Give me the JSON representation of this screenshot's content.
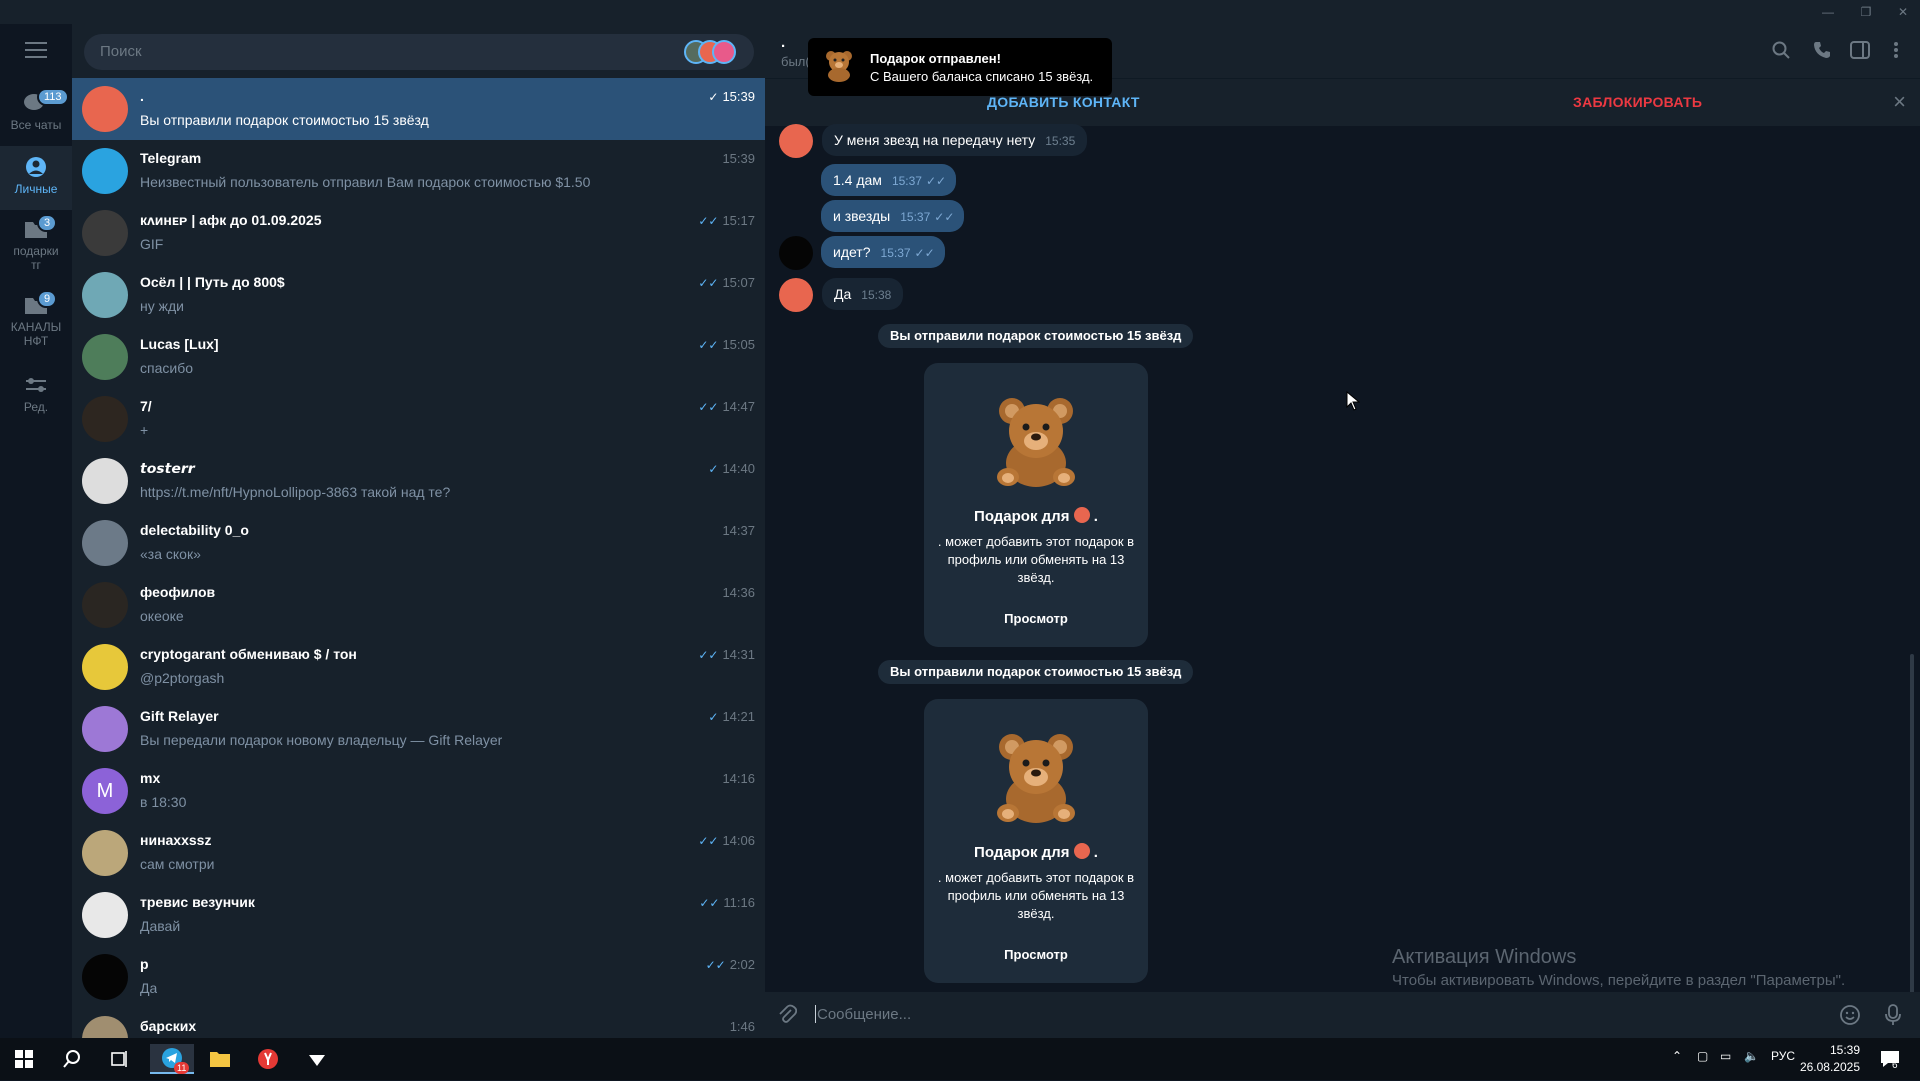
{
  "window": {
    "minimize": "—",
    "restore": "❐",
    "close": "✕"
  },
  "folders": [
    {
      "label": "Все чаты",
      "badge": "113",
      "icon": "chats-icon"
    },
    {
      "label": "Личные",
      "badge": "",
      "icon": "user-icon"
    },
    {
      "label": "подарки тг",
      "badge": "3",
      "icon": "folder-icon"
    },
    {
      "label": "КАНАЛЫ НФТ",
      "badge": "9",
      "icon": "folder-icon"
    },
    {
      "label": "Ред.",
      "badge": "",
      "icon": "edit-icon"
    }
  ],
  "search": {
    "placeholder": "Поиск"
  },
  "chats": [
    {
      "name": ".",
      "message": "Вы отправили подарок стоимостью 15 звёзд",
      "time": "15:39",
      "check": "✓",
      "color": "#e8664f"
    },
    {
      "name": "Telegram",
      "message": "Неизвестный пользователь отправил Вам подарок стоимостью $1.50",
      "time": "15:39",
      "check": "",
      "color": "#2aa3e0"
    },
    {
      "name": "кᴧинᴇᴘ | афк до 01.09.2025",
      "message": "GIF",
      "time": "15:17",
      "check": "✓✓",
      "color": "#3a3a3a"
    },
    {
      "name": "Осёл | | Путь до 800$",
      "message": "ну жди",
      "time": "15:07",
      "check": "✓✓",
      "color": "#6fa8b5"
    },
    {
      "name": "Lucas [Lux]",
      "message": "спасибо",
      "time": "15:05",
      "check": "✓✓",
      "color": "#4e7d5a"
    },
    {
      "name": "7/",
      "message": "+",
      "time": "14:47",
      "check": "✓✓",
      "color": "#2d2620"
    },
    {
      "name": "𝙩𝙤𝙨𝙩𝙚𝙧𝙧",
      "message": "https://t.me/nft/HypnoLollipop-3863 такой над те?",
      "time": "14:40",
      "check": "✓",
      "color": "#dddddd"
    },
    {
      "name": "delectability 0_o",
      "message": "«за скок»",
      "time": "14:37",
      "check": "",
      "color": "#6c7a88"
    },
    {
      "name": "феофилов",
      "message": "океоке",
      "time": "14:36",
      "check": "",
      "color": "#2a2622"
    },
    {
      "name": "cryptogarant обмениваю $ / тон",
      "message": "@p2ptorgash",
      "time": "14:31",
      "check": "✓✓",
      "color": "#e7c83a"
    },
    {
      "name": "Gift Relayer",
      "message": "Вы передали подарок новому владельцу — Gift Relayer",
      "time": "14:21",
      "check": "✓",
      "color": "#9d78d6"
    },
    {
      "name": "mx",
      "message": "в 18:30",
      "time": "14:16",
      "check": "",
      "color": "#8c62d8",
      "initial": "M"
    },
    {
      "name": "нинахxssz",
      "message": "сам смотри",
      "time": "14:06",
      "check": "✓✓",
      "color": "#bba77a"
    },
    {
      "name": "тревис везунчик",
      "message": "Давай",
      "time": "11:16",
      "check": "✓✓",
      "color": "#e8e8e8"
    },
    {
      "name": "р",
      "message": "Да",
      "time": "2:02",
      "check": "✓✓",
      "color": "#050505"
    },
    {
      "name": "барских",
      "message": "",
      "time": "1:46",
      "check": "",
      "color": "#a08e70"
    }
  ],
  "header": {
    "title": ".",
    "status": "был(а) недавно"
  },
  "toast": {
    "title": "Подарок отправлен!",
    "text": "С Вашего баланса списано 15 звёзд."
  },
  "action_bar": {
    "add_contact": "ДОБАВИТЬ КОНТАКТ",
    "block": "ЗАБЛОКИРОВАТЬ"
  },
  "messages": [
    {
      "text": "У меня звезд на передачу нету",
      "time": "15:35"
    },
    {
      "text": "1.4 дам",
      "time": "15:37"
    },
    {
      "text": "и звезды",
      "time": "15:37"
    },
    {
      "text": "идет?",
      "time": "15:37"
    },
    {
      "text": "Да",
      "time": "15:38"
    }
  ],
  "gifts": [
    {
      "service": "Вы отправили подарок стоимостью 15 звёзд",
      "title": "Подарок для",
      "title_suffix": ".",
      "desc": ". может добавить этот подарок в профиль или обменять на 13 звёзд.",
      "button": "Просмотр"
    },
    {
      "service": "Вы отправили подарок стоимостью 15 звёзд",
      "title": "Подарок для",
      "title_suffix": ".",
      "desc": ". может добавить этот подарок в профиль или обменять на 13 звёзд.",
      "button": "Просмотр"
    }
  ],
  "watermark": {
    "title": "Активация Windows",
    "text": "Чтобы активировать Windows, перейдите в раздел \"Параметры\"."
  },
  "composer": {
    "placeholder": "Сообщение..."
  },
  "taskbar": {
    "lang": "РУС",
    "time": "15:39",
    "date": "26.08.2025",
    "tg_badge": "11",
    "notif_count": "6"
  }
}
